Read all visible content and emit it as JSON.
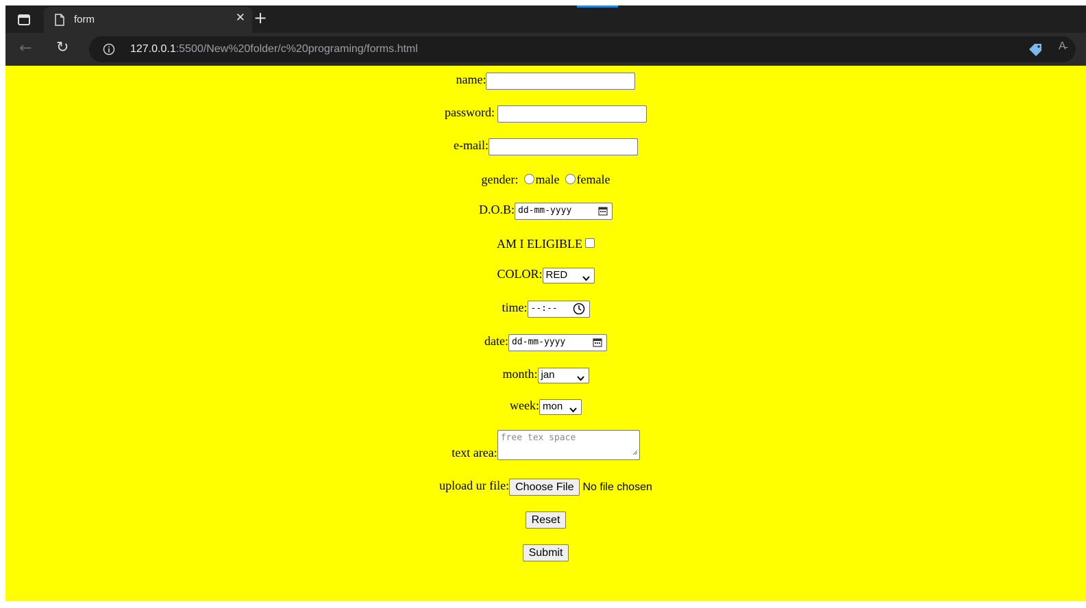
{
  "browser": {
    "tab_title": "form",
    "url_host": "127.0.0.1",
    "url_rest": ":5500/New%20folder/c%20programing/forms.html",
    "read_aloud_label": "A̵"
  },
  "page": {
    "background_color": "#ffff00",
    "name_label": "name:",
    "password_label": "password:",
    "email_label": "e-mail:",
    "gender_label": "gender:",
    "gender_options": [
      "male",
      "female"
    ],
    "dob_label": "D.O.B:",
    "dob_placeholder": "dd-mm-yyyy",
    "eligible_label": "AM I ELIGIBLE",
    "color_label": "COLOR:",
    "color_value": "RED",
    "time_label": "time:",
    "time_placeholder": "--:--",
    "date_label": "date:",
    "date_placeholder": "dd-mm-yyyy",
    "month_label": "month:",
    "month_value": "jan",
    "week_label": "week:",
    "week_value": "mon",
    "textarea_label": "text area:",
    "textarea_placeholder": "free tex space",
    "upload_label": "upload ur file:",
    "choose_file_label": "Choose File",
    "no_file_text": "No file chosen",
    "reset_label": "Reset",
    "submit_label": "Submit"
  }
}
